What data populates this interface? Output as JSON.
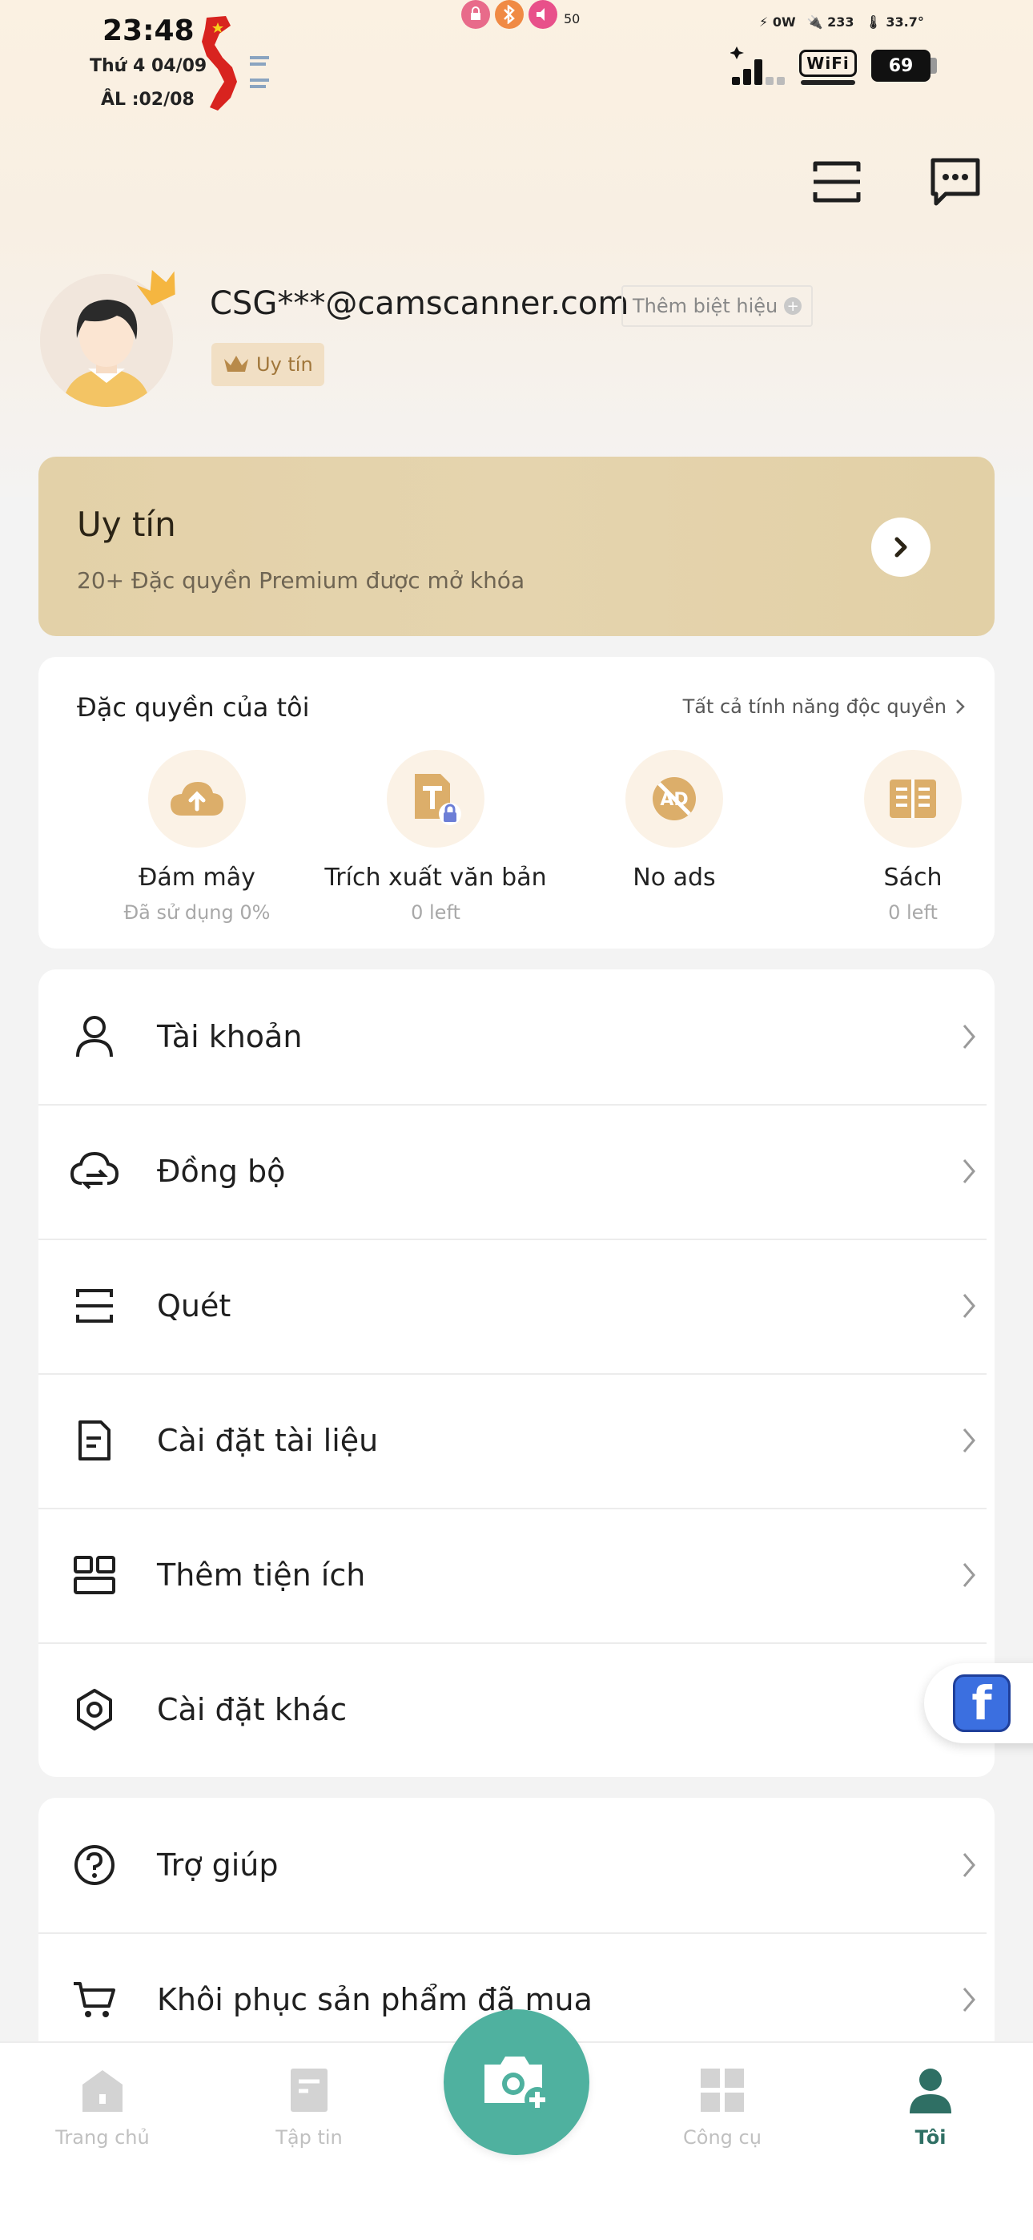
{
  "status_bar": {
    "time": "23:48",
    "date_line": "Thứ 4 04/09",
    "lunar_line": "ÂL :02/08",
    "volume_level": "50",
    "power": "0W",
    "charge": "233",
    "temperature": "33.7°",
    "wifi_label": "WiFi",
    "battery": "69"
  },
  "header": {
    "scan_icon": "scan-icon",
    "message_icon": "message-icon"
  },
  "profile": {
    "email": "CSG***@camscanner.com",
    "nickname_label": "Thêm biệt hiệu",
    "badge_label": "Uy tín"
  },
  "premium": {
    "title": "Uy tín",
    "subtitle": "20+ Đặc quyền Premium được mở khóa"
  },
  "privileges": {
    "title": "Đặc quyền của tôi",
    "all_link": "Tất cả tính năng độc quyền",
    "items": [
      {
        "name": "Đám mây",
        "sub": "Đã sử dụng  0%"
      },
      {
        "name": "Trích xuất văn bản",
        "sub": "0 left"
      },
      {
        "name": "No ads",
        "sub": ""
      },
      {
        "name": "Sách",
        "sub": "0 left"
      }
    ]
  },
  "menu_main": [
    {
      "label": "Tài khoản",
      "icon": "user-icon"
    },
    {
      "label": "Đồng bộ",
      "icon": "cloud-sync-icon"
    },
    {
      "label": "Quét",
      "icon": "scan-icon"
    },
    {
      "label": "Cài đặt tài liệu",
      "icon": "document-icon"
    },
    {
      "label": "Thêm tiện ích",
      "icon": "widgets-icon"
    },
    {
      "label": "Cài đặt khác",
      "icon": "gear-icon"
    }
  ],
  "menu_help": [
    {
      "label": "Trợ giúp",
      "icon": "help-icon"
    },
    {
      "label": "Khôi phục sản phẩm đã mua",
      "icon": "cart-icon"
    }
  ],
  "bottom_nav": [
    {
      "label": "Trang chủ",
      "active": false
    },
    {
      "label": "Tập tin",
      "active": false
    },
    {
      "label": "Công cụ",
      "active": false
    },
    {
      "label": "Tôi",
      "active": true
    }
  ],
  "colors": {
    "accent": "#4fb19f",
    "active_tab": "#2f6f64",
    "premium_bg": "#e3d1a8",
    "facebook": "#3b6fe0"
  }
}
